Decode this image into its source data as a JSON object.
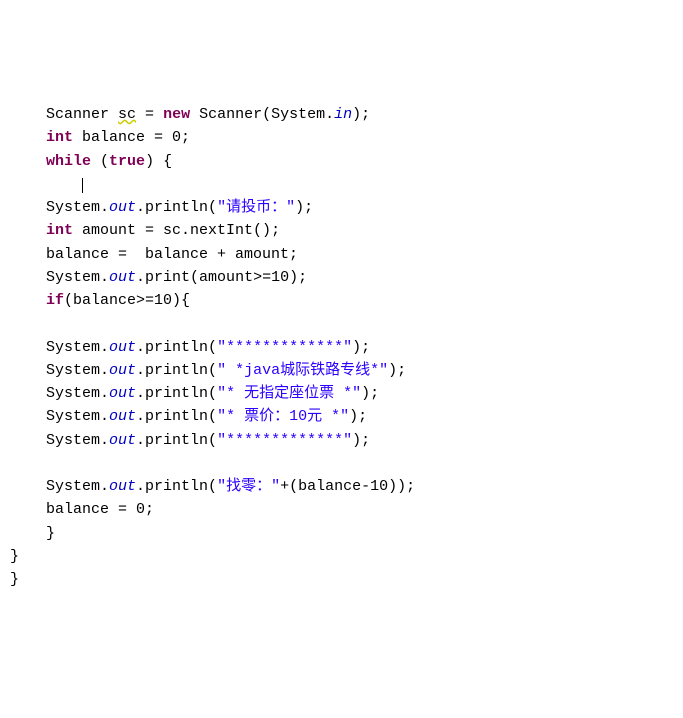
{
  "code": {
    "indent1": "    ",
    "indent2": "    ",
    "kw_new": "new",
    "kw_int": "int",
    "kw_while": "while",
    "kw_true": "true",
    "kw_if": "if",
    "fld_in": "in",
    "fld_out": "out",
    "line1_a": "Scanner ",
    "line1_sc": "sc",
    "line1_b": " = ",
    "line1_c": " Scanner(System.",
    "line1_d": ");",
    "line2_a": " balance = 0;",
    "line3_a": " (",
    "line3_b": ") {",
    "line4_cursor": " ",
    "line5_a": "System.",
    "line5_b": ".println(",
    "line5_str": "\"请投币：\"",
    "line5_c": ");",
    "line6_a": " amount = sc.nextInt();",
    "line7_a": "balance =  balance + amount;",
    "line8_a": "System.",
    "line8_b": ".print(amount>=10);",
    "line9_a": "(balance>=10){",
    "line11_a": "System.",
    "line11_b": ".println(",
    "line11_str": "\"*************\"",
    "line11_c": ");",
    "line12_a": "System.",
    "line12_b": ".println(",
    "line12_str": "\" *java城际铁路专线*\"",
    "line12_c": ");",
    "line13_a": "System.",
    "line13_b": ".println(",
    "line13_str": "\"* 无指定座位票 *\"",
    "line13_c": ");",
    "line14_a": "System.",
    "line14_b": ".println(",
    "line14_str": "\"* 票价：10元 *\"",
    "line14_c": ");",
    "line15_a": "System.",
    "line15_b": ".println(",
    "line15_str": "\"*************\"",
    "line15_c": ");",
    "line17_a": "System.",
    "line17_b": ".println(",
    "line17_str": "\"找零：\"",
    "line17_c": "+(balance-10));",
    "line18_a": "balance = 0;",
    "line19_a": "}",
    "line20_a": "}",
    "line21_a": "}"
  }
}
